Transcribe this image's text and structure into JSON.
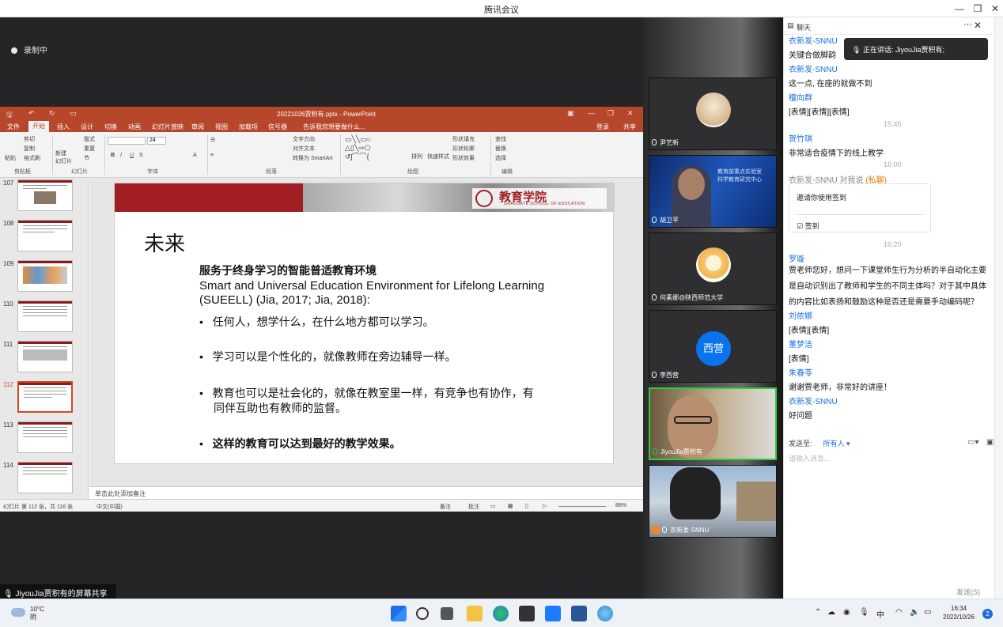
{
  "window": {
    "title": "腾讯会议"
  },
  "meeting": {
    "recording_label": "录制中",
    "share_label": "JiyouJia贾积有的屏幕共享"
  },
  "ppt": {
    "file_title": "20221026贾积有.pptx - PowerPoint",
    "tabs": [
      "文件",
      "开始",
      "插入",
      "设计",
      "切换",
      "动画",
      "幻灯片放映",
      "审阅",
      "视图",
      "加载项",
      "信号器",
      "告诉我您想要做什么..."
    ],
    "active_tab": "开始",
    "login": "登录",
    "share": "共享",
    "ribbon_groups": [
      "剪贴板",
      "幻灯片",
      "字体",
      "段落",
      "绘图",
      "编辑"
    ],
    "ribbon_buttons": {
      "paste": "粘贴",
      "cut": "剪切",
      "copy": "复制",
      "format": "格式刷",
      "new_slide": "新建\n幻灯片",
      "layout": "版式",
      "reset": "重置",
      "section": "节",
      "font_size": "24",
      "text_dir": "文字方向",
      "align_text": "对齐文本",
      "smartart": "转换为 SmartArt",
      "arrange": "排列",
      "quick_styles": "快速样式",
      "fill": "形状填充",
      "outline": "形状轮廓",
      "effects": "形状效果",
      "find": "查找",
      "replace": "替换",
      "select": "选择"
    },
    "thumbnails": [
      "107",
      "108",
      "109",
      "110",
      "111",
      "112",
      "113",
      "114"
    ],
    "selected_slide": "112",
    "slide": {
      "logo_cn": "教育学院",
      "logo_en": "GRADUATE SCHOOL OF EDUCATION",
      "title": "未来",
      "subtitle": "服务于终身学习的智能普适教育环境",
      "english": "Smart and Universal Education Environment for Lifelong Learning (SUEELL) (Jia, 2017; Jia, 2018):",
      "bullets": [
        "任何人，想学什么，在什么地方都可以学习。",
        "学习可以是个性化的，就像教师在旁边辅导一样。",
        "教育也可以是社会化的，就像在教室里一样，有竞争也有协作，有同伴互助也有教师的监督。",
        "这样的教育可以达到最好的教学效果。"
      ]
    },
    "notes_placeholder": "单击此处添加备注",
    "status": {
      "slide_count": "幻灯片 第 112 张，共 116 张",
      "language": "中文(中国)",
      "notes": "备注",
      "comments": "批注",
      "zoom": "88%"
    }
  },
  "participants": [
    {
      "name": "尹艺新",
      "type": "avatar"
    },
    {
      "name": "胡卫平",
      "type": "video"
    },
    {
      "name": "何素娜@陕西师范大学",
      "type": "avatar"
    },
    {
      "name": "李西营",
      "type": "text-avatar",
      "avatar_text": "西营"
    },
    {
      "name": "JiyouJia贾积有",
      "type": "video"
    },
    {
      "name": "衣新发-SNNU",
      "type": "video"
    }
  ],
  "chat": {
    "header": "聊天",
    "toast": "正在讲话: JiyouJia贾积有;",
    "messages": [
      {
        "sender": "衣新发-SNNU",
        "text": "关键合做脚韵"
      },
      {
        "sender": "衣新发-SNNU",
        "text": "这一点, 在座的就做不到"
      },
      {
        "sender": "檀向群",
        "text": "[表情][表情][表情]"
      },
      {
        "time": "15:45"
      },
      {
        "sender": "贺竹琪",
        "text": "非常适合疫情下的线上教学"
      },
      {
        "time": "16:00"
      },
      {
        "sender": "衣新发-SNNU",
        "private_to": "对我说",
        "private_tag": "(私聊)",
        "card_text": "邀请你使用签到",
        "card_action": "签到"
      },
      {
        "time": "16:20"
      },
      {
        "sender": "罗璇",
        "text": "贾老师您好，想问一下课堂师生行为分析的半自动化主要是自动识别出了教师和学生的不同主体吗？对于其中具体的内容比如表扬和鼓励这种是否还是需要手动编码呢？"
      },
      {
        "sender": "刘依娜",
        "text": "[表情][表情]"
      },
      {
        "sender": "董梦洁",
        "text": "[表情]"
      },
      {
        "sender": "朱春苓",
        "text": "谢谢贾老师，非常好的讲座！"
      },
      {
        "sender": "衣新发-SNNU",
        "text": "好问题"
      }
    ],
    "send_to_label": "发送至:",
    "send_to_value": "所有人",
    "input_placeholder": "请输入消息...",
    "send_button": "发送(S)"
  },
  "taskbar": {
    "weather_temp": "10°C",
    "weather_desc": "阴",
    "ime": "中",
    "time": "16:34",
    "date": "2022/10/26",
    "notifications": "2"
  }
}
